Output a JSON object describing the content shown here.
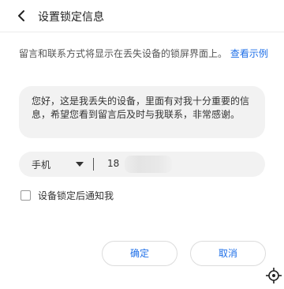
{
  "header": {
    "title": "设置锁定信息",
    "back_icon": "chevron-left-icon"
  },
  "description": {
    "text": "留言和联系方式将显示在丢失设备的锁屏界面上。",
    "link_label": "查看示例"
  },
  "message": {
    "text": "您好，这是我丢失的设备，里面有对我十分重要的信息，希望您看到留言后及时与我联系，非常感谢。"
  },
  "contact": {
    "type_label": "手机",
    "phone_value": "18"
  },
  "checkbox": {
    "label": "设备锁定后通知我",
    "checked": false
  },
  "buttons": {
    "ok_label": "确定",
    "cancel_label": "取消"
  },
  "colors": {
    "accent": "#1e6fe8",
    "field_bg": "#f2f2f2"
  }
}
